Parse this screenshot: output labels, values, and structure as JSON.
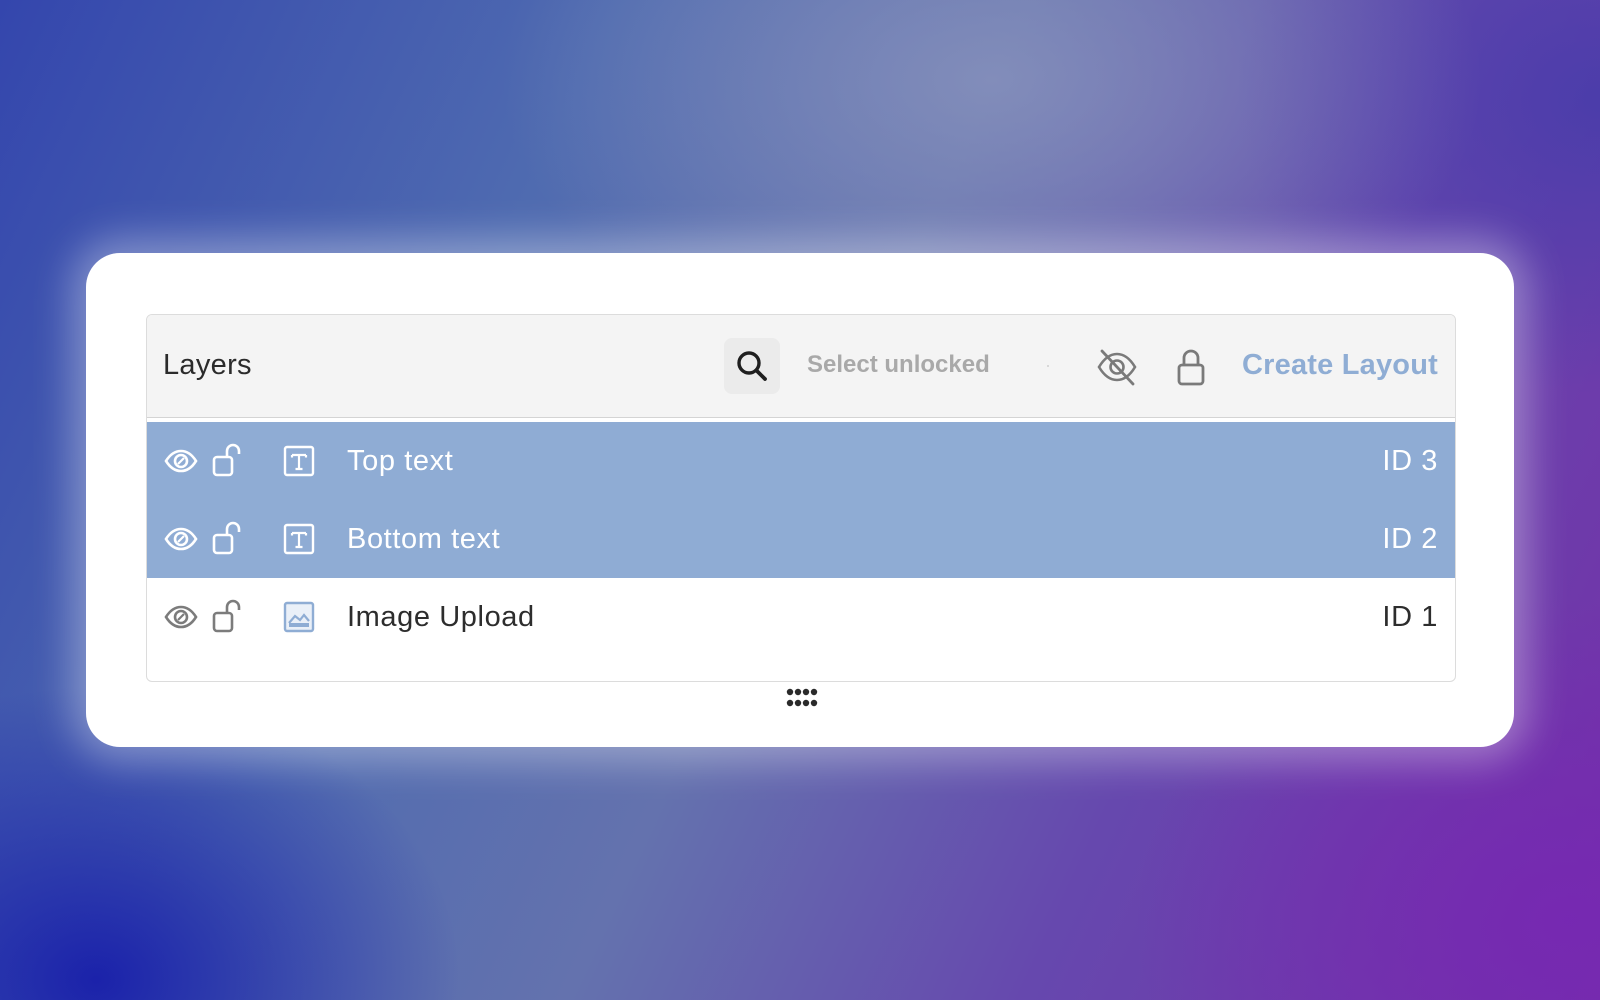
{
  "panel": {
    "title": "Layers",
    "search_icon": "search-icon",
    "select_unlocked_label": "Select unlocked",
    "hide_all_icon": "eye-off-icon",
    "lock_all_icon": "lock-icon",
    "create_layout_label": "Create Layout"
  },
  "layers": [
    {
      "name": "Top text",
      "id_label": "ID 3",
      "type_icon": "text-icon",
      "selected": true
    },
    {
      "name": "Bottom text",
      "id_label": "ID 2",
      "type_icon": "text-icon",
      "selected": true
    },
    {
      "name": "Image Upload",
      "id_label": "ID 1",
      "type_icon": "image-icon",
      "selected": false
    }
  ],
  "colors": {
    "selected_row": "#8facd4",
    "accent_text": "#8fadd4",
    "header_bg": "#f4f4f4"
  },
  "drag_handle_icon": "drag-handle-icon"
}
